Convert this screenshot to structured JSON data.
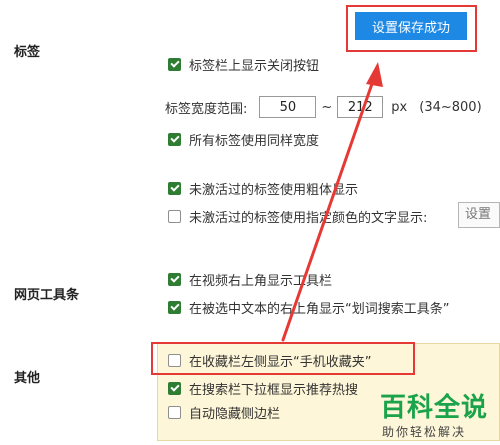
{
  "header": {
    "save_button": "设置保存成功"
  },
  "sections": {
    "tabs": {
      "label": "标签",
      "show_close_button": {
        "label": "标签栏上显示关闭按钮",
        "checked": true
      },
      "width_range": {
        "label": "标签宽度范围:",
        "min": "50",
        "separator": "~",
        "max": "212",
        "unit": "px",
        "hint": "(34~800)"
      },
      "same_width": {
        "label": "所有标签使用同样宽度",
        "checked": true
      },
      "bold_inactive": {
        "label": "未激活过的标签使用粗体显示",
        "checked": true
      },
      "color_inactive": {
        "label": "未激活过的标签使用指定颜色的文字显示:",
        "checked": false
      },
      "color_setting_button": "设置"
    },
    "toolbar": {
      "label": "网页工具条",
      "video_toolbar": {
        "label": "在视频右上角显示工具栏",
        "checked": true
      },
      "selection_toolbar": {
        "label": "在被选中文本的右上角显示“划词搜索工具条”",
        "checked": true
      }
    },
    "other": {
      "label": "其他",
      "mobile_favorites": {
        "label": "在收藏栏左侧显示“手机收藏夹”",
        "checked": false
      },
      "search_suggest": {
        "label": "在搜索栏下拉框显示推荐热搜",
        "checked": true
      },
      "auto_hide_sidebar": {
        "label": "自动隐藏侧边栏",
        "checked": false
      }
    }
  },
  "watermark": {
    "title": "百科全说",
    "subtitle": "助你轻松解决"
  },
  "colors": {
    "accent": "#1e88e5",
    "checkbox_checked": "#2e7d32",
    "annotation_red": "#e53935",
    "highlight_panel": "#fdf6d8",
    "logo_green": "#1aa34a"
  }
}
